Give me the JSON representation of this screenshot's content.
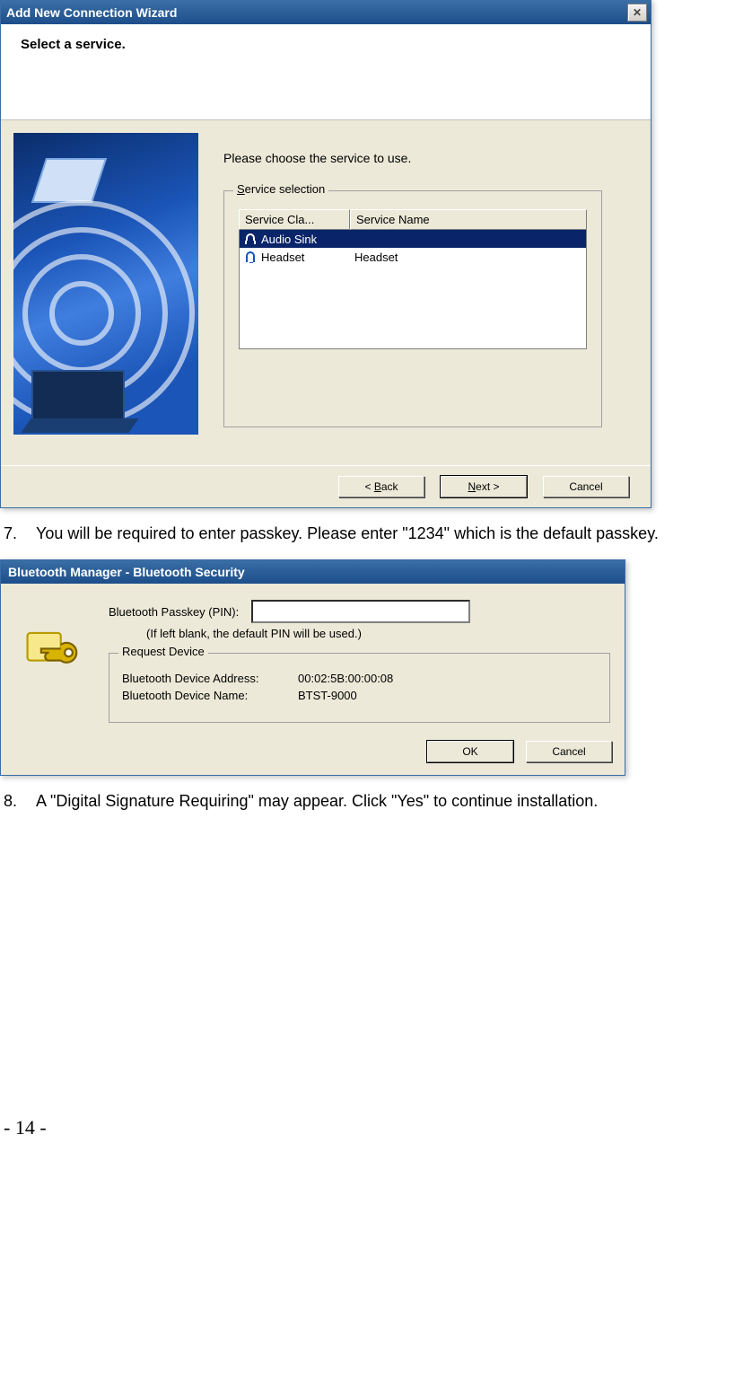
{
  "wizard": {
    "title": "Add New Connection Wizard",
    "close_glyph": "✕",
    "subheader": "Select a service.",
    "instruction": "Please choose the service to use.",
    "group_legend_prefix": "S",
    "group_legend_rest": "ervice selection",
    "col1": "Service Cla...",
    "col2": "Service Name",
    "rows": [
      {
        "icon": "headphones",
        "c1": "Audio Sink",
        "c2": "",
        "selected": true
      },
      {
        "icon": "headset",
        "c1": "Headset",
        "c2": "Headset",
        "selected": false
      }
    ],
    "back_prefix": "< ",
    "back_accel": "B",
    "back_rest": "ack",
    "next_accel": "N",
    "next_rest": "ext >",
    "cancel": "Cancel"
  },
  "step7": {
    "num": "7.",
    "text": "You will be required to enter passkey. Please enter \"1234\" which is the default passkey."
  },
  "security": {
    "title": "Bluetooth Manager - Bluetooth Security",
    "pin_label": "Bluetooth Passkey (PIN):",
    "pin_value": "",
    "hint": "(If left blank, the default PIN will be used.)",
    "group_label": "Request Device",
    "addr_k": "Bluetooth Device Address:",
    "addr_v": "00:02:5B:00:00:08",
    "name_k": "Bluetooth Device Name:",
    "name_v": "BTST-9000",
    "ok": "OK",
    "cancel": "Cancel"
  },
  "step8": {
    "num": "8.",
    "text": "A \"Digital Signature Requiring\" may appear. Click \"Yes\" to continue installation."
  },
  "page_number": "- 14 -"
}
